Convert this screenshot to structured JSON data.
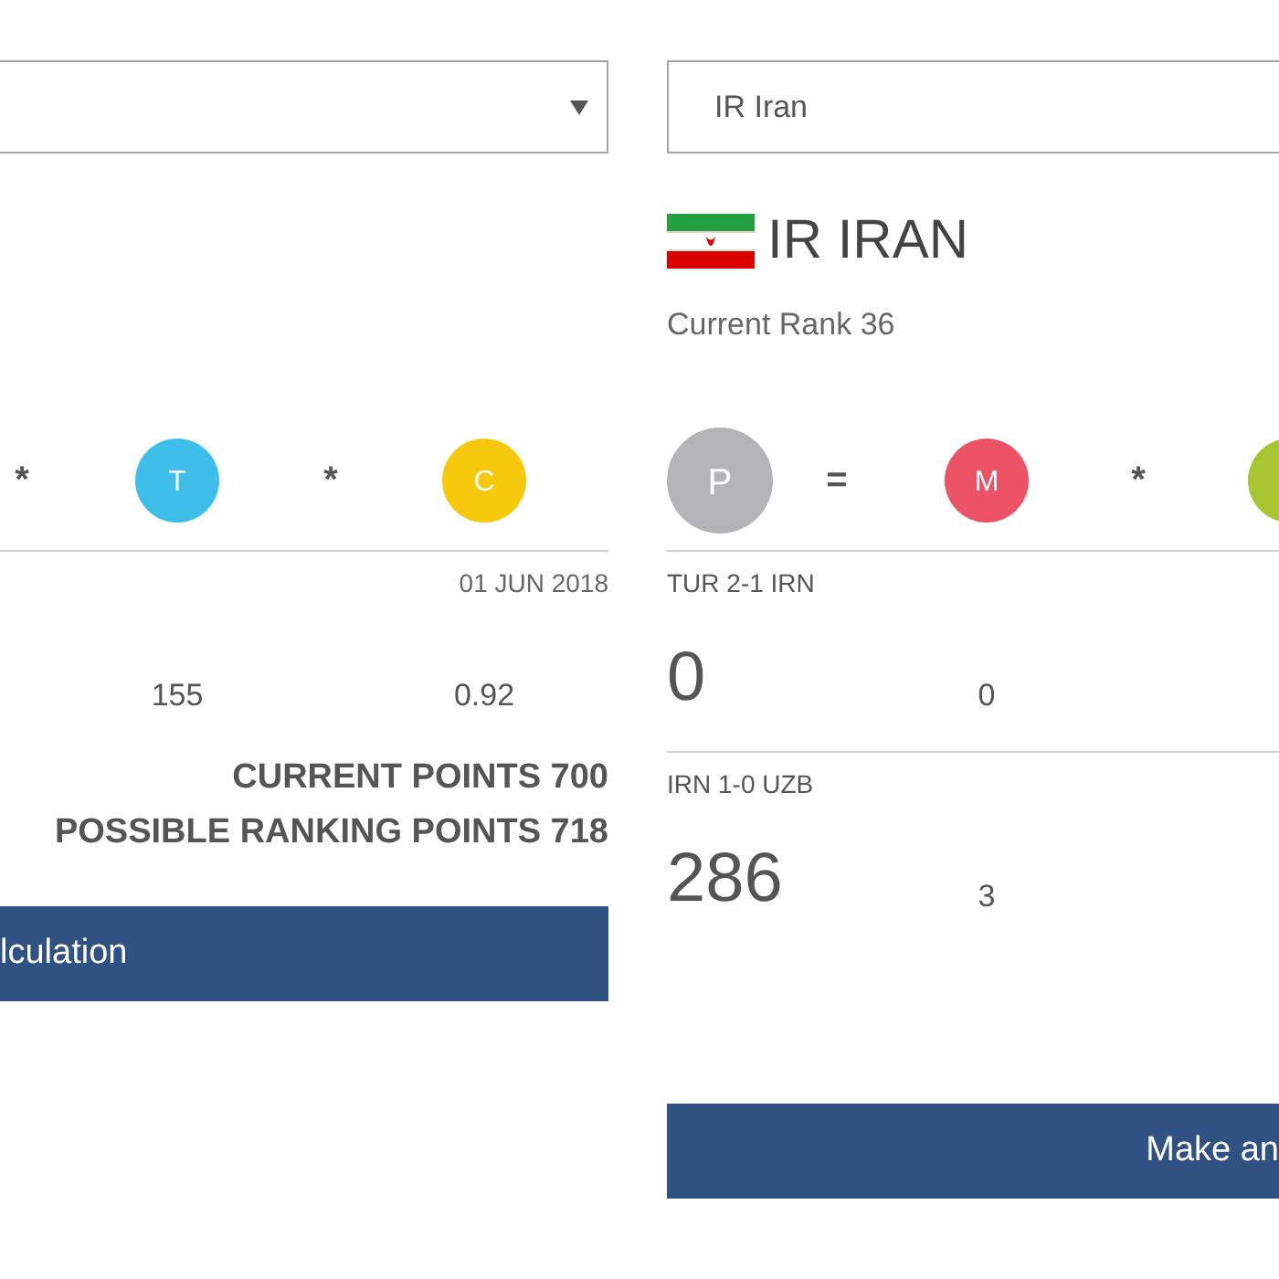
{
  "panels": [
    {
      "selector": {
        "kind": "dropdown"
      },
      "formula": [
        {
          "kind": "operator",
          "symbol": "*"
        },
        {
          "kind": "factor",
          "letter": "T",
          "color": "#3dbfea"
        },
        {
          "kind": "operator",
          "symbol": "*"
        },
        {
          "kind": "factor",
          "letter": "C",
          "color": "#f7c90d"
        }
      ],
      "matches": [
        {
          "date": "01 JUN 2018",
          "values": [
            "155",
            "0.92"
          ]
        }
      ],
      "totals": [
        "CURRENT POINTS 700",
        "POSSIBLE RANKING POINTS 718"
      ],
      "button": {
        "label": "lculation"
      }
    },
    {
      "selector": {
        "kind": "field",
        "value": "IR Iran"
      },
      "country": {
        "name": "IR IRAN",
        "rank": "Current Rank 36"
      },
      "formula": [
        {
          "kind": "result",
          "letter": "P",
          "color": "#b4b4b7"
        },
        {
          "kind": "operator",
          "symbol": "="
        },
        {
          "kind": "factor",
          "letter": "M",
          "color": "#ec5367"
        },
        {
          "kind": "operator",
          "symbol": "*"
        },
        {
          "kind": "factor",
          "color": "#a7c431"
        }
      ],
      "matches": [
        {
          "score": "TUR 2-1 IRN",
          "result": "0",
          "values": [
            "0"
          ]
        },
        {
          "score": "IRN 1-0 UZB",
          "result": "286",
          "values": [
            "3"
          ]
        }
      ],
      "button": {
        "label": "Make an"
      }
    }
  ]
}
